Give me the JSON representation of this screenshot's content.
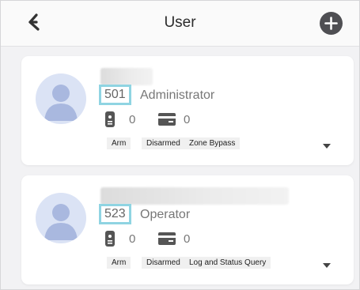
{
  "header": {
    "title": "User",
    "back_icon": "back-arrow-icon",
    "add_icon": "plus-circle-icon"
  },
  "users": [
    {
      "id": "501",
      "role": "Administrator",
      "keyfob_count": "0",
      "card_count": "0",
      "permissions": [
        "Arm",
        "Disarmed",
        "Zone Bypass"
      ]
    },
    {
      "id": "523",
      "role": "Operator",
      "keyfob_count": "0",
      "card_count": "0",
      "permissions": [
        "Arm",
        "Disarmed",
        "Log and Status Query"
      ]
    }
  ],
  "colors": {
    "id_highlight": "#8fd4e2",
    "avatar_bg": "#dbe3f5",
    "avatar_fg": "#a9b8df",
    "add_button": "#4f4f53"
  }
}
